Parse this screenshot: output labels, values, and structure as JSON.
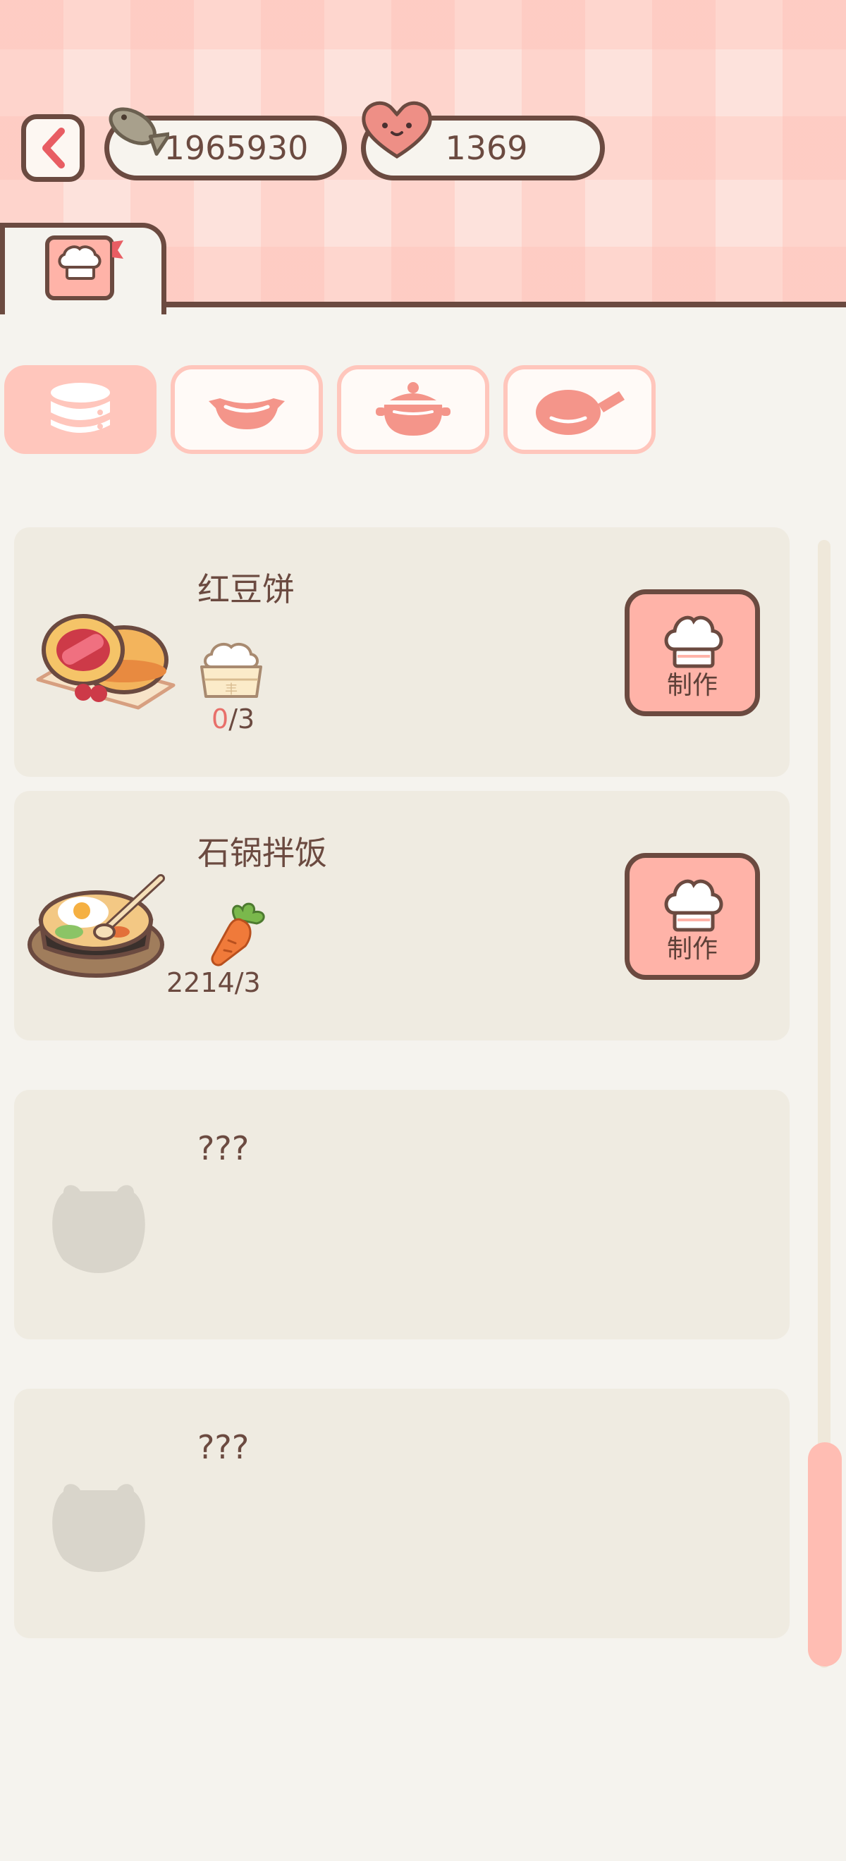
{
  "currency": {
    "fish": {
      "icon": "fish-icon",
      "value": "1965930"
    },
    "heart": {
      "icon": "heart-face-icon",
      "value": "1369"
    }
  },
  "tab": {
    "icon": "chef-book-icon"
  },
  "categories": [
    {
      "icon": "stacked-plates-icon",
      "active": true
    },
    {
      "icon": "serving-bowl-icon",
      "active": false
    },
    {
      "icon": "cooking-pot-icon",
      "active": false
    },
    {
      "icon": "frying-pan-icon",
      "active": false
    }
  ],
  "recipes": [
    {
      "name": "红豆饼",
      "dish_icon": "red-bean-cake-icon",
      "ingredient_icon": "steamed-bun-basket-icon",
      "have": "0",
      "need": "/3",
      "make_label": "制作"
    },
    {
      "name": "石锅拌饭",
      "dish_icon": "stone-pot-bibimbap-icon",
      "ingredient_icon": "carrot-icon",
      "have": "2214",
      "need": "/3",
      "make_label": "制作"
    },
    {
      "name": "???",
      "dish_icon": "locked-dish-silhouette-icon"
    },
    {
      "name": "???",
      "dish_icon": "locked-dish-silhouette-icon"
    }
  ],
  "colors": {
    "accent": "#ffb3a8",
    "outline": "#6b4a40",
    "background": "#f5f3ee",
    "card": "#efebe1",
    "short_count": "#e8706a"
  }
}
